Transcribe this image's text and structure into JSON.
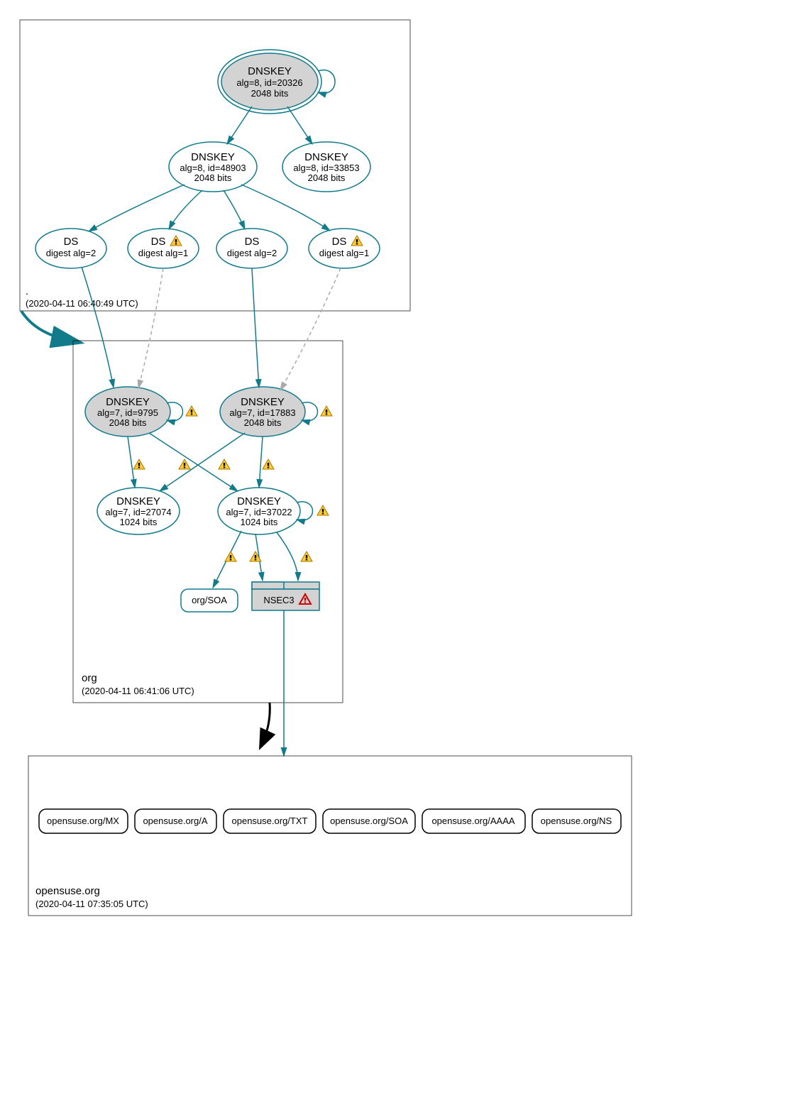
{
  "zones": {
    "root": {
      "label": ".",
      "timestamp": "(2020-04-11 06:40:49 UTC)"
    },
    "org": {
      "label": "org",
      "timestamp": "(2020-04-11 06:41:06 UTC)"
    },
    "opensuse": {
      "label": "opensuse.org",
      "timestamp": "(2020-04-11 07:35:05 UTC)"
    }
  },
  "nodes": {
    "rootKSK": {
      "title": "DNSKEY",
      "l1": "alg=8, id=20326",
      "l2": "2048 bits"
    },
    "rootZSK1": {
      "title": "DNSKEY",
      "l1": "alg=8, id=48903",
      "l2": "2048 bits"
    },
    "rootZSK2": {
      "title": "DNSKEY",
      "l1": "alg=8, id=33853",
      "l2": "2048 bits"
    },
    "ds1": {
      "title": "DS",
      "l1": "digest alg=2"
    },
    "ds2": {
      "title": "DS",
      "l1": "digest alg=1"
    },
    "ds3": {
      "title": "DS",
      "l1": "digest alg=2"
    },
    "ds4": {
      "title": "DS",
      "l1": "digest alg=1"
    },
    "orgK1": {
      "title": "DNSKEY",
      "l1": "alg=7, id=9795",
      "l2": "2048 bits"
    },
    "orgK2": {
      "title": "DNSKEY",
      "l1": "alg=7, id=17883",
      "l2": "2048 bits"
    },
    "orgK3": {
      "title": "DNSKEY",
      "l1": "alg=7, id=27074",
      "l2": "1024 bits"
    },
    "orgK4": {
      "title": "DNSKEY",
      "l1": "alg=7, id=37022",
      "l2": "1024 bits"
    },
    "orgSOA": {
      "title": "org/SOA"
    },
    "nsec3": {
      "title": "NSEC3"
    }
  },
  "records": {
    "r1": "opensuse.org/MX",
    "r2": "opensuse.org/A",
    "r3": "opensuse.org/TXT",
    "r4": "opensuse.org/SOA",
    "r5": "opensuse.org/AAAA",
    "r6": "opensuse.org/NS"
  },
  "icons": {
    "warn": "warning-triangle-yellow",
    "error": "warning-triangle-red"
  }
}
